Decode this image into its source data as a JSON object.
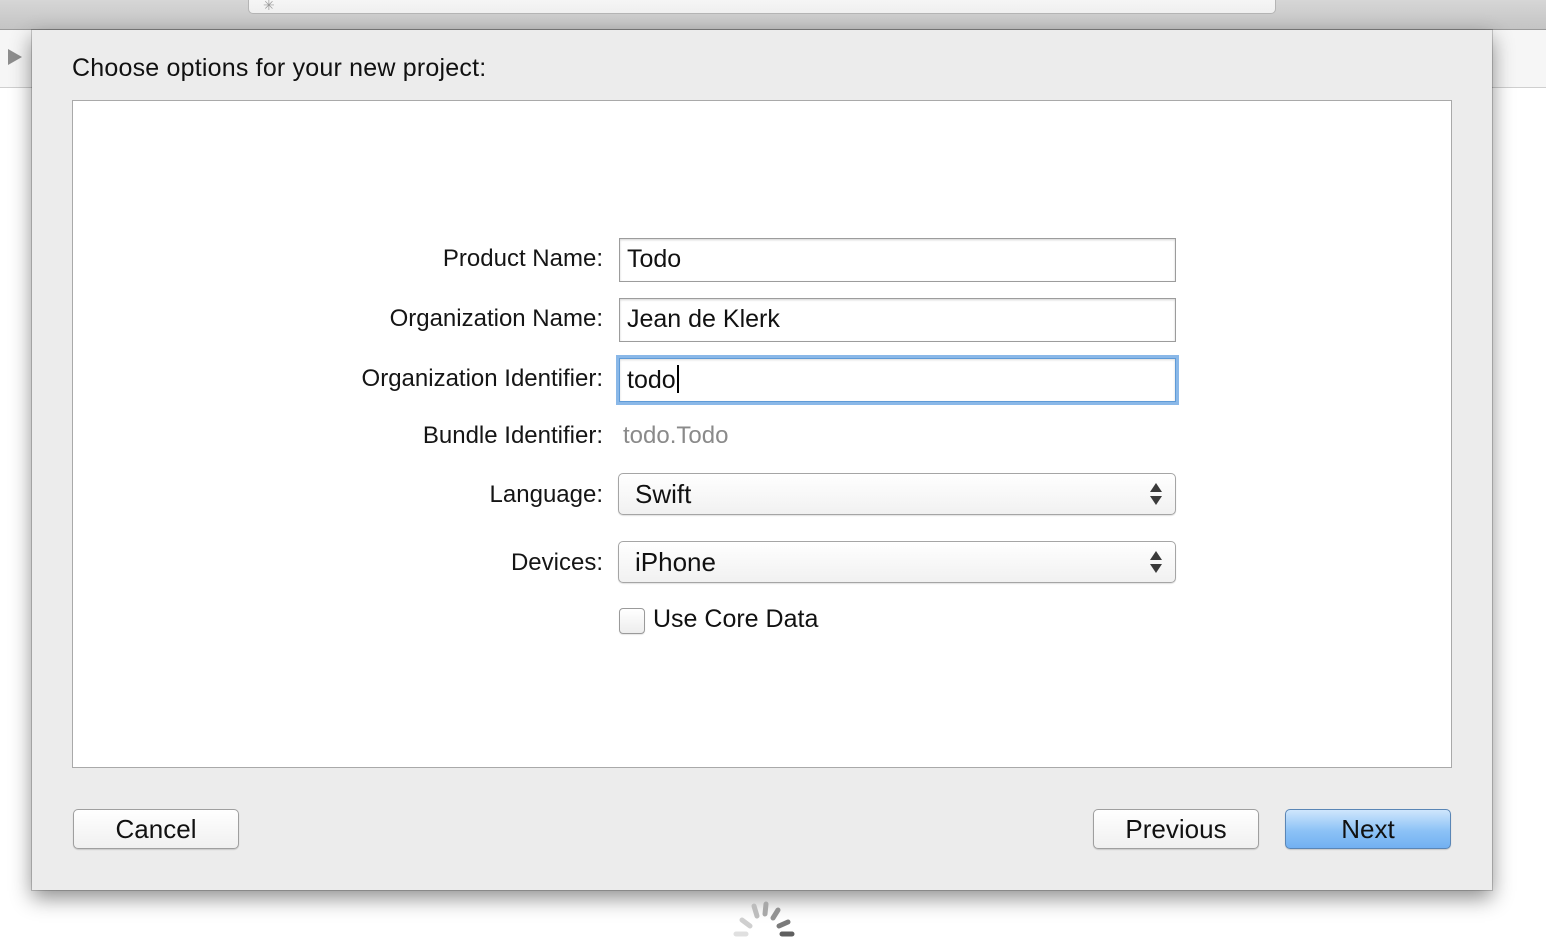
{
  "sheet": {
    "title": "Choose options for your new project:"
  },
  "form": {
    "product_name": {
      "label": "Product Name:",
      "value": "Todo"
    },
    "organization_name": {
      "label": "Organization Name:",
      "value": "Jean de Klerk"
    },
    "organization_identifier": {
      "label": "Organization Identifier:",
      "value": "todo"
    },
    "bundle_identifier": {
      "label": "Bundle Identifier:",
      "value": "todo.Todo"
    },
    "language": {
      "label": "Language:",
      "selected": "Swift"
    },
    "devices": {
      "label": "Devices:",
      "selected": "iPhone"
    },
    "use_core_data": {
      "label": "Use Core Data",
      "checked": false
    }
  },
  "buttons": {
    "cancel": "Cancel",
    "previous": "Previous",
    "next": "Next"
  },
  "icons": {
    "activity": "spinner-icon",
    "disclosure": "disclosure-triangle-icon",
    "popup_arrows": "up-down-arrows-icon",
    "loading": "loading-spinner-icon"
  },
  "colors": {
    "focus_ring": "#8ab8e8",
    "primary_button": "#8cc2f6",
    "secondary_text": "#8a8a8a"
  }
}
